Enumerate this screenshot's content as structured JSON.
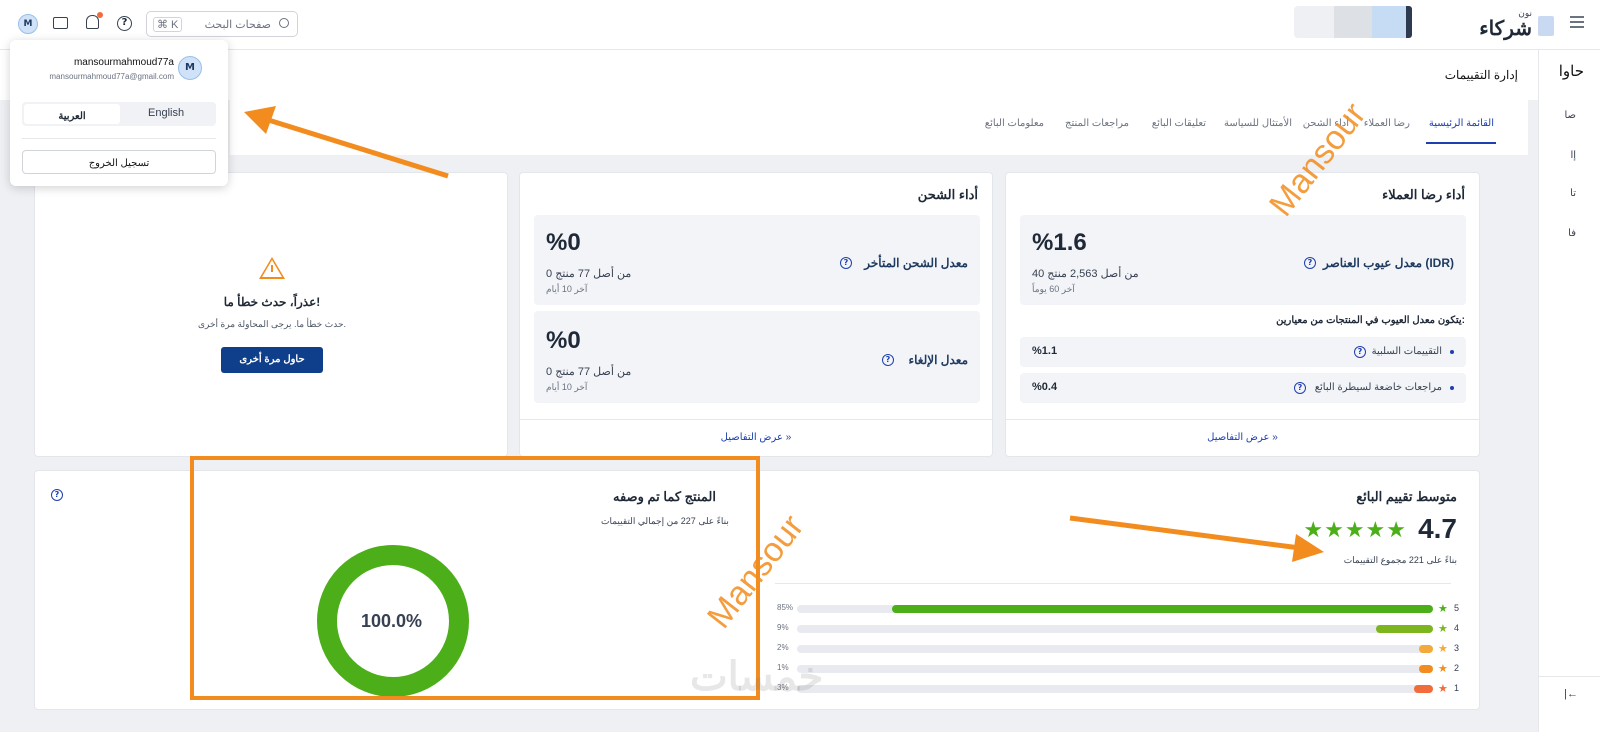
{
  "topbar": {
    "brand": "شركاء",
    "brand_super": "نون",
    "search_placeholder": "صفحات البحث",
    "search_shortcut": "⌘ K",
    "avatar_letter": "M"
  },
  "profile_menu": {
    "username": "mansourmahmoud77a",
    "email": "mansourmahmoud77a@gmail.com",
    "avatar_letter": "M",
    "lang_english": "English",
    "lang_arabic": "العربية",
    "logout": "تسجيل الخروج"
  },
  "rail": {
    "title": "حاوا",
    "items": [
      "صا",
      "إا",
      "تا",
      "فا"
    ],
    "collapse": "|←"
  },
  "page_title": "إدارة التقييمات",
  "tabs": [
    "القائمة الرئيسية",
    "رضا العملاء",
    "أداء الشحن",
    "الأمتثال للسياسة",
    "تعليقات البائع",
    "مراجعات المنتج",
    "معلومات البائع"
  ],
  "error_card": {
    "title": "عذراً، حدث خطأ ما!",
    "message": "حدث خطأ ما. يرجى المحاولة مرة أخرى.",
    "retry": "حاول مرة أخرى"
  },
  "shipping": {
    "title": "أداء الشحن",
    "late_label": "معدل الشحن المتأخر",
    "late_value": "%0",
    "late_sub": "0 من أصل 77 منتج",
    "late_period": "آخر 10 أيام",
    "cancel_label": "معدل الإلغاء",
    "cancel_value": "%0",
    "cancel_sub": "0 من أصل 77 منتج",
    "cancel_period": "آخر 10 أيام",
    "details": "عرض التفاصيل »"
  },
  "satisfaction": {
    "title": "أداء رضا العملاء",
    "idr_label": "معدل عيوب العناصر (IDR)",
    "idr_value": "%1.6",
    "idr_sub": "40 من أصل 2,563 منتج",
    "idr_period": "آخر 60 يوماً",
    "criteria_title": "يتكون معدل العيوب في المنتجات من معيارين:",
    "neg_label": "التقييمات السلبية",
    "neg_value": "%1.1",
    "seller_label": "مراجعات خاضعة لسيطرة البائع",
    "seller_value": "%0.4",
    "details": "عرض التفاصيل »"
  },
  "rating": {
    "title": "متوسط تقييم البائع",
    "value": "4.7",
    "stars": "★★★★★",
    "based_on": "بناءً على 221 مجموع التقييمات",
    "rows": [
      {
        "star": "5",
        "pct": "85%",
        "fraction": 0.85,
        "color": "#4caf1a"
      },
      {
        "star": "4",
        "pct": "9%",
        "fraction": 0.09,
        "color": "#7cb51e"
      },
      {
        "star": "3",
        "pct": "2%",
        "fraction": 0.02,
        "color": "#f4a93b"
      },
      {
        "star": "2",
        "pct": "1%",
        "fraction": 0.01,
        "color": "#f28c1e"
      },
      {
        "star": "1",
        "pct": "3%",
        "fraction": 0.03,
        "color": "#f26b3a"
      }
    ]
  },
  "described": {
    "title": "المنتج كما تم وصفه",
    "based_on": "بناءً على 227 من إجمالي التقييمات",
    "percent": "100.0%",
    "fraction": 1.0
  },
  "watermarks": {
    "name": "Mansour",
    "logo": "خمسات"
  }
}
